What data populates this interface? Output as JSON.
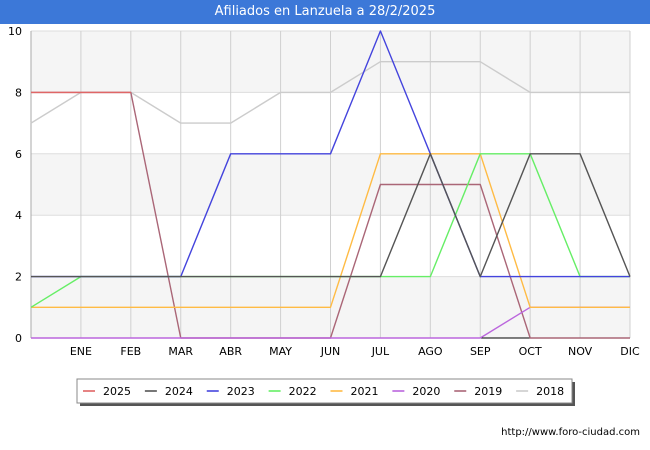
{
  "chart_data": {
    "type": "line",
    "title": "Afiliados en Lanzuela a 28/2/2025",
    "xlabel": "",
    "ylabel": "",
    "categories": [
      "",
      "ENE",
      "FEB",
      "MAR",
      "ABR",
      "MAY",
      "JUN",
      "JUL",
      "AGO",
      "SEP",
      "OCT",
      "NOV",
      "DIC"
    ],
    "ylim": [
      0,
      10
    ],
    "yticks": [
      0,
      2,
      4,
      6,
      8,
      10
    ],
    "grid": true,
    "legend_position": "bottom",
    "series": [
      {
        "name": "2025",
        "color": "#e06666",
        "values": [
          8,
          8,
          8,
          null,
          null,
          null,
          null,
          null,
          null,
          null,
          null,
          null,
          null
        ]
      },
      {
        "name": "2024",
        "color": "#555555",
        "values": [
          2,
          2,
          2,
          2,
          2,
          2,
          2,
          2,
          6,
          2,
          6,
          6,
          2
        ]
      },
      {
        "name": "2023",
        "color": "#4444dd",
        "values": [
          2,
          2,
          2,
          2,
          6,
          6,
          6,
          10,
          6,
          2,
          2,
          2,
          2
        ]
      },
      {
        "name": "2022",
        "color": "#66ee66",
        "values": [
          1,
          2,
          2,
          2,
          2,
          2,
          2,
          2,
          2,
          6,
          6,
          2,
          2
        ]
      },
      {
        "name": "2021",
        "color": "#ffbb44",
        "values": [
          1,
          1,
          1,
          1,
          1,
          1,
          1,
          6,
          6,
          6,
          1,
          1,
          1
        ]
      },
      {
        "name": "2020",
        "color": "#bb66dd",
        "values": [
          0,
          0,
          0,
          0,
          0,
          0,
          0,
          0,
          0,
          0,
          1,
          1,
          1
        ]
      },
      {
        "name": "2019",
        "color": "#aa6677",
        "values": [
          8,
          8,
          8,
          0,
          0,
          0,
          0,
          5,
          5,
          5,
          0,
          0,
          0
        ]
      },
      {
        "name": "2018",
        "color": "#cccccc",
        "values": [
          7,
          8,
          8,
          7,
          7,
          8,
          8,
          9,
          9,
          9,
          8,
          8,
          8
        ]
      }
    ]
  },
  "footer": {
    "source": "http://www.foro-ciudad.com"
  }
}
